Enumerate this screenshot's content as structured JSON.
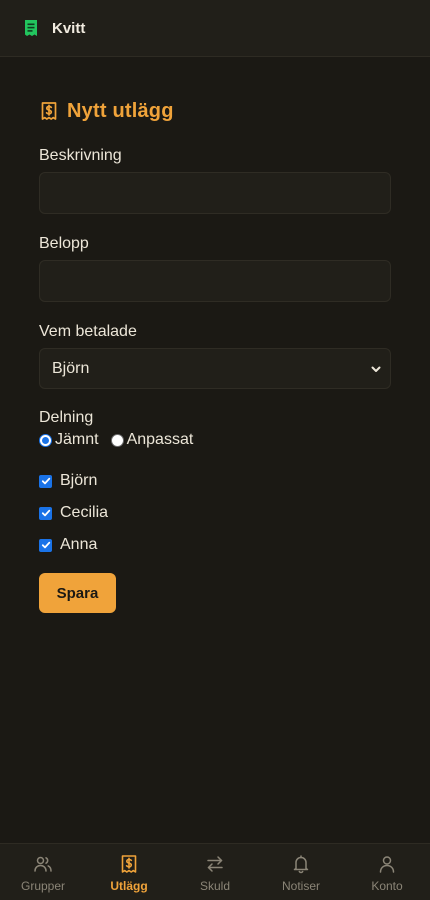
{
  "app": {
    "name": "Kvitt"
  },
  "colors": {
    "accent": "#f0a33a",
    "background": "#1b1914",
    "surface": "#211f19",
    "nav_inactive": "#8b8577"
  },
  "form": {
    "title": "Nytt utlägg",
    "title_icon": "receipt-dollar-icon",
    "description": {
      "label": "Beskrivning",
      "value": ""
    },
    "amount": {
      "label": "Belopp",
      "value": ""
    },
    "payer": {
      "label": "Vem betalade",
      "selected": "Björn"
    },
    "split": {
      "label": "Delning",
      "options": [
        {
          "label": "Jämnt",
          "checked": true
        },
        {
          "label": "Anpassat",
          "checked": false
        }
      ]
    },
    "participants": [
      {
        "name": "Björn",
        "checked": true
      },
      {
        "name": "Cecilia",
        "checked": true
      },
      {
        "name": "Anna",
        "checked": true
      }
    ],
    "save_label": "Spara"
  },
  "nav": [
    {
      "label": "Grupper",
      "icon": "users-icon",
      "active": false
    },
    {
      "label": "Utlägg",
      "icon": "receipt-dollar-icon",
      "active": true
    },
    {
      "label": "Skuld",
      "icon": "arrows-swap-icon",
      "active": false
    },
    {
      "label": "Notiser",
      "icon": "bell-icon",
      "active": false
    },
    {
      "label": "Konto",
      "icon": "user-icon",
      "active": false
    }
  ]
}
